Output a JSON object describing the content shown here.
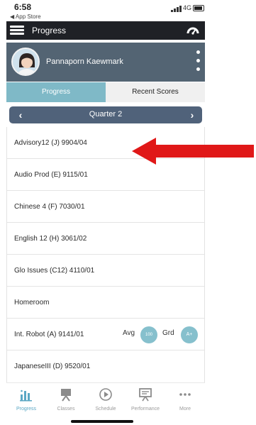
{
  "status_bar": {
    "time": "6:58",
    "back_app": "◀ App Store",
    "network": "4G"
  },
  "nav": {
    "title": "Progress"
  },
  "profile": {
    "student_name": "Pannaporn Kaewmark"
  },
  "tabs": [
    {
      "label": "Progress",
      "active": true
    },
    {
      "label": "Recent Scores",
      "active": false
    }
  ],
  "quarter": {
    "label": "Quarter 2"
  },
  "courses": [
    {
      "name": "Advisory12 (J) 9904/04"
    },
    {
      "name": "Audio Prod (E) 9115/01"
    },
    {
      "name": "Chinese 4 (F) 7030/01"
    },
    {
      "name": "English 12 (H) 3061/02"
    },
    {
      "name": "Glo Issues (C12) 4110/01"
    },
    {
      "name": "Homeroom"
    },
    {
      "name": "Int. Robot (A) 9141/01",
      "avg_label": "Avg",
      "avg_value": "100",
      "grade_label": "Grd",
      "grade_value": "A+"
    },
    {
      "name": "JapaneseIII (D) 9520/01"
    }
  ],
  "bottom_nav": [
    {
      "label": "Progress",
      "icon": "bar-chart-icon",
      "active": true
    },
    {
      "label": "Classes",
      "icon": "easel-icon",
      "active": false
    },
    {
      "label": "Schedule",
      "icon": "clock-icon",
      "active": false
    },
    {
      "label": "Performance",
      "icon": "presentation-icon",
      "active": false
    },
    {
      "label": "More",
      "icon": "more-dots-icon",
      "active": false
    }
  ],
  "colors": {
    "nav_bg": "#1f2126",
    "profile_bg": "#536473",
    "tab_active": "#7fb9c7",
    "quarter_bg": "#50627a",
    "badge": "#86c0cd",
    "arrow": "#e01818"
  }
}
